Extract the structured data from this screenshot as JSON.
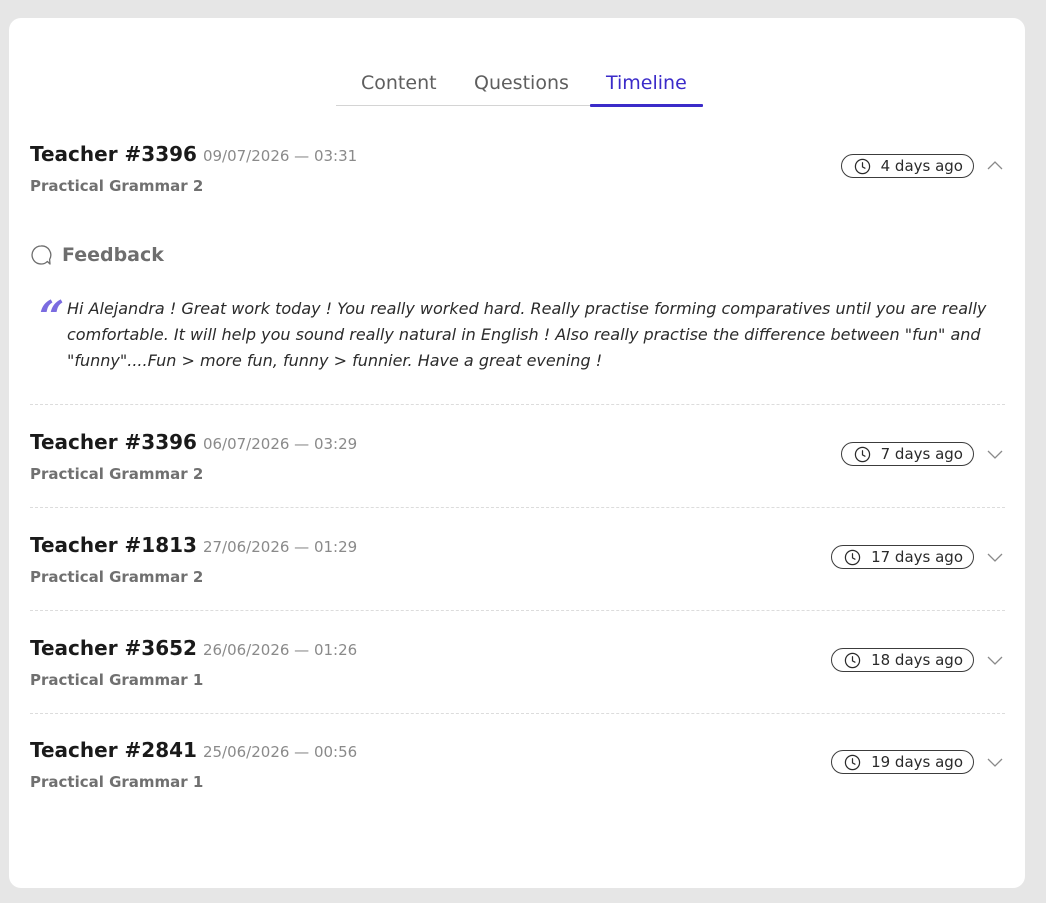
{
  "tabs": [
    {
      "label": "Content"
    },
    {
      "label": "Questions"
    },
    {
      "label": "Timeline"
    }
  ],
  "entries": [
    {
      "teacher": "Teacher #3396",
      "date": "09/07/2026 — 03:31",
      "course": "Practical Grammar 2",
      "ago": "4 days ago",
      "expanded": true
    },
    {
      "teacher": "Teacher #3396",
      "date": "06/07/2026 — 03:29",
      "course": "Practical Grammar 2",
      "ago": "7 days ago",
      "expanded": false
    },
    {
      "teacher": "Teacher #1813",
      "date": "27/06/2026 — 01:29",
      "course": "Practical Grammar 2",
      "ago": "17 days ago",
      "expanded": false
    },
    {
      "teacher": "Teacher #3652",
      "date": "26/06/2026 — 01:26",
      "course": "Practical Grammar 1",
      "ago": "18 days ago",
      "expanded": false
    },
    {
      "teacher": "Teacher #2841",
      "date": "25/06/2026 — 00:56",
      "course": "Practical Grammar 1",
      "ago": "19 days ago",
      "expanded": false
    }
  ],
  "feedback": {
    "heading": "Feedback",
    "text": "Hi Alejandra ! Great work today ! You really worked hard. Really practise forming comparatives until you are really comfortable. It will help you sound really natural in English ! Also really practise the difference between \"fun\" and \"funny\"....Fun > more fun, funny > funnier. Have a great evening !"
  },
  "colors": {
    "accent": "#3b2bc9",
    "quote": "#7a6be0"
  }
}
